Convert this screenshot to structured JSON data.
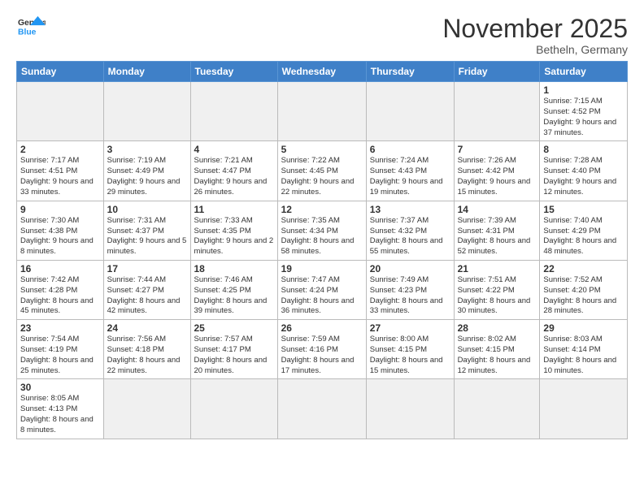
{
  "header": {
    "logo_general": "General",
    "logo_blue": "Blue",
    "month": "November 2025",
    "location": "Betheln, Germany"
  },
  "weekdays": [
    "Sunday",
    "Monday",
    "Tuesday",
    "Wednesday",
    "Thursday",
    "Friday",
    "Saturday"
  ],
  "weeks": [
    [
      {
        "day": "",
        "info": ""
      },
      {
        "day": "",
        "info": ""
      },
      {
        "day": "",
        "info": ""
      },
      {
        "day": "",
        "info": ""
      },
      {
        "day": "",
        "info": ""
      },
      {
        "day": "",
        "info": ""
      },
      {
        "day": "1",
        "info": "Sunrise: 7:15 AM\nSunset: 4:52 PM\nDaylight: 9 hours and 37 minutes."
      }
    ],
    [
      {
        "day": "2",
        "info": "Sunrise: 7:17 AM\nSunset: 4:51 PM\nDaylight: 9 hours and 33 minutes."
      },
      {
        "day": "3",
        "info": "Sunrise: 7:19 AM\nSunset: 4:49 PM\nDaylight: 9 hours and 29 minutes."
      },
      {
        "day": "4",
        "info": "Sunrise: 7:21 AM\nSunset: 4:47 PM\nDaylight: 9 hours and 26 minutes."
      },
      {
        "day": "5",
        "info": "Sunrise: 7:22 AM\nSunset: 4:45 PM\nDaylight: 9 hours and 22 minutes."
      },
      {
        "day": "6",
        "info": "Sunrise: 7:24 AM\nSunset: 4:43 PM\nDaylight: 9 hours and 19 minutes."
      },
      {
        "day": "7",
        "info": "Sunrise: 7:26 AM\nSunset: 4:42 PM\nDaylight: 9 hours and 15 minutes."
      },
      {
        "day": "8",
        "info": "Sunrise: 7:28 AM\nSunset: 4:40 PM\nDaylight: 9 hours and 12 minutes."
      }
    ],
    [
      {
        "day": "9",
        "info": "Sunrise: 7:30 AM\nSunset: 4:38 PM\nDaylight: 9 hours and 8 minutes."
      },
      {
        "day": "10",
        "info": "Sunrise: 7:31 AM\nSunset: 4:37 PM\nDaylight: 9 hours and 5 minutes."
      },
      {
        "day": "11",
        "info": "Sunrise: 7:33 AM\nSunset: 4:35 PM\nDaylight: 9 hours and 2 minutes."
      },
      {
        "day": "12",
        "info": "Sunrise: 7:35 AM\nSunset: 4:34 PM\nDaylight: 8 hours and 58 minutes."
      },
      {
        "day": "13",
        "info": "Sunrise: 7:37 AM\nSunset: 4:32 PM\nDaylight: 8 hours and 55 minutes."
      },
      {
        "day": "14",
        "info": "Sunrise: 7:39 AM\nSunset: 4:31 PM\nDaylight: 8 hours and 52 minutes."
      },
      {
        "day": "15",
        "info": "Sunrise: 7:40 AM\nSunset: 4:29 PM\nDaylight: 8 hours and 48 minutes."
      }
    ],
    [
      {
        "day": "16",
        "info": "Sunrise: 7:42 AM\nSunset: 4:28 PM\nDaylight: 8 hours and 45 minutes."
      },
      {
        "day": "17",
        "info": "Sunrise: 7:44 AM\nSunset: 4:27 PM\nDaylight: 8 hours and 42 minutes."
      },
      {
        "day": "18",
        "info": "Sunrise: 7:46 AM\nSunset: 4:25 PM\nDaylight: 8 hours and 39 minutes."
      },
      {
        "day": "19",
        "info": "Sunrise: 7:47 AM\nSunset: 4:24 PM\nDaylight: 8 hours and 36 minutes."
      },
      {
        "day": "20",
        "info": "Sunrise: 7:49 AM\nSunset: 4:23 PM\nDaylight: 8 hours and 33 minutes."
      },
      {
        "day": "21",
        "info": "Sunrise: 7:51 AM\nSunset: 4:22 PM\nDaylight: 8 hours and 30 minutes."
      },
      {
        "day": "22",
        "info": "Sunrise: 7:52 AM\nSunset: 4:20 PM\nDaylight: 8 hours and 28 minutes."
      }
    ],
    [
      {
        "day": "23",
        "info": "Sunrise: 7:54 AM\nSunset: 4:19 PM\nDaylight: 8 hours and 25 minutes."
      },
      {
        "day": "24",
        "info": "Sunrise: 7:56 AM\nSunset: 4:18 PM\nDaylight: 8 hours and 22 minutes."
      },
      {
        "day": "25",
        "info": "Sunrise: 7:57 AM\nSunset: 4:17 PM\nDaylight: 8 hours and 20 minutes."
      },
      {
        "day": "26",
        "info": "Sunrise: 7:59 AM\nSunset: 4:16 PM\nDaylight: 8 hours and 17 minutes."
      },
      {
        "day": "27",
        "info": "Sunrise: 8:00 AM\nSunset: 4:15 PM\nDaylight: 8 hours and 15 minutes."
      },
      {
        "day": "28",
        "info": "Sunrise: 8:02 AM\nSunset: 4:15 PM\nDaylight: 8 hours and 12 minutes."
      },
      {
        "day": "29",
        "info": "Sunrise: 8:03 AM\nSunset: 4:14 PM\nDaylight: 8 hours and 10 minutes."
      }
    ],
    [
      {
        "day": "30",
        "info": "Sunrise: 8:05 AM\nSunset: 4:13 PM\nDaylight: 8 hours and 8 minutes."
      },
      {
        "day": "",
        "info": ""
      },
      {
        "day": "",
        "info": ""
      },
      {
        "day": "",
        "info": ""
      },
      {
        "day": "",
        "info": ""
      },
      {
        "day": "",
        "info": ""
      },
      {
        "day": "",
        "info": ""
      }
    ]
  ]
}
